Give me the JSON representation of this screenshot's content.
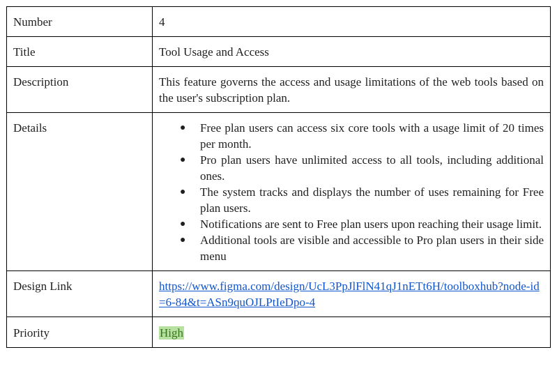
{
  "rows": {
    "number": {
      "label": "Number",
      "value": "4"
    },
    "title": {
      "label": "Title",
      "value": "Tool Usage and Access"
    },
    "description": {
      "label": "Description",
      "value": "This feature governs the access and usage limitations of the web tools based on the user's subscription plan."
    },
    "details": {
      "label": "Details",
      "bullet_glyph": "●",
      "items": [
        "Free plan users can access six core tools with a usage limit of 20 times per month.",
        "Pro plan users have unlimited access to all tools, including additional ones.",
        "The system tracks and displays the number of uses remaining for Free plan users.",
        "Notifications are sent to Free plan users upon reaching their usage limit.",
        "Additional tools are visible and accessible to Pro plan users in their side menu"
      ]
    },
    "design_link": {
      "label": "Design Link",
      "url": "https://www.figma.com/design/UcL3PpJlFlN41qJ1nETt6H/toolboxhub?node-id=6-84&t=ASn9quOJLPtIeDpo-4"
    },
    "priority": {
      "label": "Priority",
      "value": "High",
      "highlight_color": "#b7e1a1",
      "text_color": "#38761d"
    }
  }
}
